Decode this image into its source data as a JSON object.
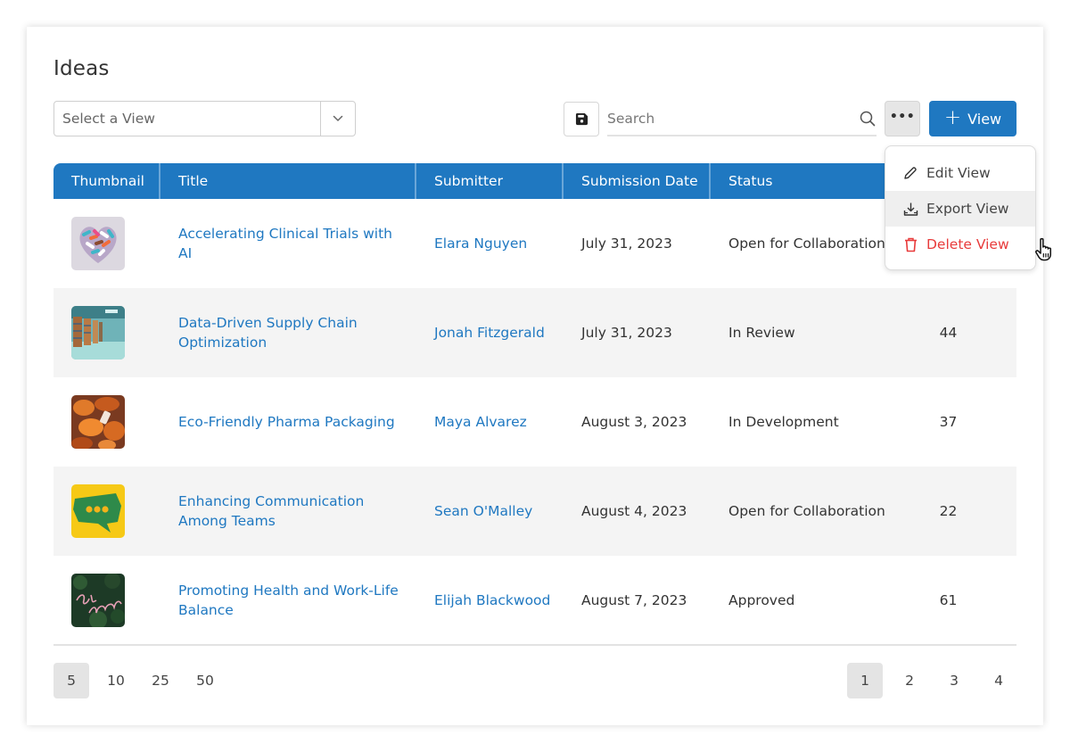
{
  "page": {
    "title": "Ideas"
  },
  "toolbar": {
    "view_select_placeholder": "Select a View",
    "search_placeholder": "Search",
    "search_value": "",
    "more_label": "•••",
    "add_view_plus": "+",
    "add_view_label": "View"
  },
  "menu": {
    "items": [
      {
        "label": "Edit View",
        "icon": "pencil-icon",
        "state": "normal"
      },
      {
        "label": "Export View",
        "icon": "download-icon",
        "state": "hover"
      },
      {
        "label": "Delete View",
        "icon": "trash-icon",
        "state": "danger"
      }
    ]
  },
  "colors": {
    "primary": "#1f78c1",
    "danger": "#e83b3b",
    "row_alt": "#f4f4f4",
    "text": "#333333"
  },
  "table": {
    "columns": [
      "Thumbnail",
      "Title",
      "Submitter",
      "Submission Date",
      "Status",
      ""
    ],
    "rows": [
      {
        "thumbnail": "pills-heart-image",
        "title": "Accelerating Clinical Trials with AI",
        "submitter": "Elara Nguyen",
        "date": "July 31, 2023",
        "status": "Open for Collaboration",
        "count": ""
      },
      {
        "thumbnail": "warehouse-image",
        "title": "Data-Driven Supply Chain Optimization",
        "submitter": "Jonah Fitzgerald",
        "date": "July 31, 2023",
        "status": "In Review",
        "count": "44"
      },
      {
        "thumbnail": "pill-bottles-image",
        "title": "Eco-Friendly Pharma Packaging",
        "submitter": "Maya Alvarez",
        "date": "August 3, 2023",
        "status": "In Development",
        "count": "37"
      },
      {
        "thumbnail": "speech-bubble-image",
        "title": "Enhancing Communication Among Teams",
        "submitter": "Sean O'Malley",
        "date": "August 4, 2023",
        "status": "Open for Collaboration",
        "count": "22"
      },
      {
        "thumbnail": "neon-breathe-image",
        "title": "Promoting Health and Work-Life Balance",
        "submitter": "Elijah Blackwood",
        "date": "August 7, 2023",
        "status": "Approved",
        "count": "61"
      }
    ]
  },
  "pagination": {
    "page_sizes": [
      "5",
      "10",
      "25",
      "50"
    ],
    "active_page_size": "5",
    "pages": [
      "1",
      "2",
      "3",
      "4"
    ],
    "active_page": "1"
  }
}
